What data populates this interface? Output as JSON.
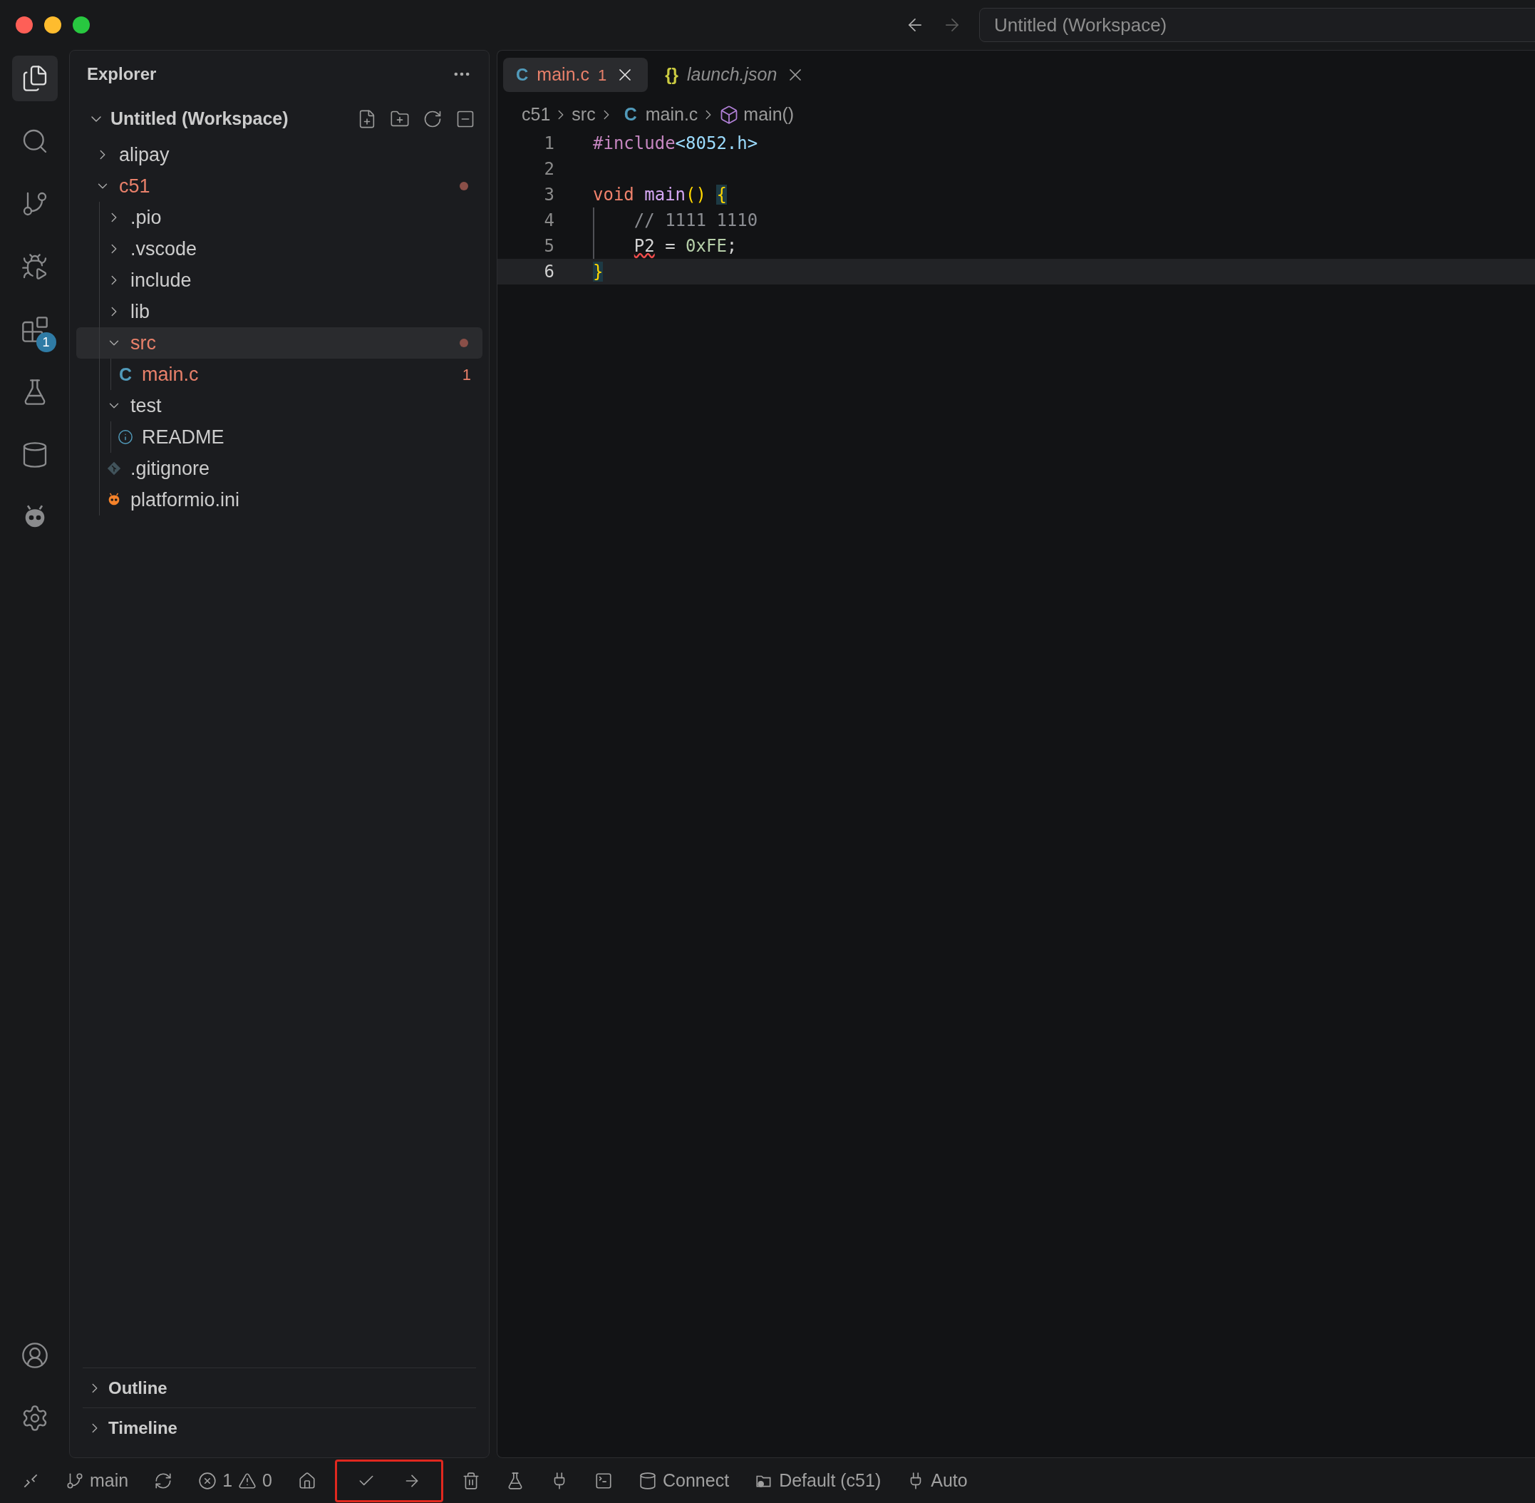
{
  "window": {
    "title": "Untitled (Workspace)",
    "back_enabled": true,
    "forward_enabled": false
  },
  "activity_bar": {
    "items": [
      {
        "kind": "files",
        "selected": true
      },
      {
        "kind": "search",
        "selected": false
      },
      {
        "kind": "source-control",
        "selected": false
      },
      {
        "kind": "run-debug",
        "selected": false
      },
      {
        "kind": "extensions",
        "selected": false,
        "badge": "1"
      },
      {
        "kind": "testing",
        "selected": false
      },
      {
        "kind": "database",
        "selected": false
      },
      {
        "kind": "platformio",
        "selected": false
      }
    ],
    "bottom": [
      {
        "kind": "account"
      },
      {
        "kind": "settings"
      }
    ]
  },
  "explorer": {
    "title": "Explorer",
    "workspace": {
      "label": "Untitled (Workspace)",
      "expanded": true
    },
    "tree": [
      {
        "label": "alipay",
        "kind": "folder",
        "expanded": false,
        "selected": false,
        "error": false
      },
      {
        "label": "c51",
        "kind": "folder",
        "expanded": true,
        "selected": false,
        "error": true,
        "children": [
          {
            "label": ".pio",
            "kind": "folder",
            "expanded": false,
            "selected": false,
            "error": false
          },
          {
            "label": ".vscode",
            "kind": "folder",
            "expanded": false,
            "selected": false,
            "error": false
          },
          {
            "label": "include",
            "kind": "folder",
            "expanded": false,
            "selected": false,
            "error": false
          },
          {
            "label": "lib",
            "kind": "folder",
            "expanded": false,
            "selected": false,
            "error": false
          },
          {
            "label": "src",
            "kind": "folder",
            "expanded": true,
            "selected": true,
            "error": true,
            "children": [
              {
                "label": "main.c",
                "kind": "glyph-file",
                "icon": "C",
                "selected": false,
                "error": true,
                "problems": "1"
              }
            ]
          },
          {
            "label": "test",
            "kind": "folder",
            "expanded": true,
            "selected": false,
            "error": false,
            "children": [
              {
                "label": "README",
                "kind": "info-file",
                "selected": false,
                "error": false
              }
            ]
          },
          {
            "label": ".gitignore",
            "kind": "git-file",
            "selected": false,
            "error": false
          },
          {
            "label": "platformio.ini",
            "kind": "platformio-file",
            "selected": false,
            "error": false
          }
        ]
      }
    ],
    "sections": [
      {
        "label": "Outline",
        "expanded": false
      },
      {
        "label": "Timeline",
        "expanded": false
      }
    ]
  },
  "editor": {
    "tabs": [
      {
        "label": "main.c",
        "icon": "C",
        "kind": "c",
        "problems": "1",
        "error": true,
        "selected": true,
        "preview": false
      },
      {
        "label": "launch.json",
        "icon": "{}",
        "kind": "json",
        "selected": false,
        "preview": true,
        "error": false
      }
    ],
    "breadcrumbs": [
      {
        "label": "c51",
        "kind": "folder"
      },
      {
        "label": "src",
        "kind": "folder"
      },
      {
        "label": "main.c",
        "kind": "file",
        "icon": "C"
      },
      {
        "label": "main()",
        "kind": "function"
      }
    ],
    "lines": [
      {
        "number": "1",
        "current": false,
        "tokens": [
          {
            "text": "#include",
            "kind": "directive"
          },
          {
            "text": "<8052.h>",
            "kind": "header"
          }
        ]
      },
      {
        "number": "2",
        "current": false
      },
      {
        "number": "3",
        "current": false,
        "tokens": [
          {
            "text": "void ",
            "kind": "keyword"
          },
          {
            "text": "main",
            "kind": "function"
          },
          {
            "text": "() ",
            "kind": "bracket"
          },
          {
            "text": "{",
            "kind": "bracket",
            "matched": true
          }
        ]
      },
      {
        "number": "4",
        "current": false,
        "tokens": [
          {
            "text": "    // 1111 1110",
            "kind": "comment"
          }
        ]
      },
      {
        "number": "5",
        "current": false,
        "tokens": [
          {
            "text": "    P2",
            "kind": "plain",
            "error": true
          },
          {
            "text": " = ",
            "kind": "plain"
          },
          {
            "text": "0xFE",
            "kind": "number"
          },
          {
            "text": ";",
            "kind": "plain"
          }
        ]
      },
      {
        "number": "6",
        "current": true,
        "tokens": [
          {
            "text": "}",
            "kind": "bracket",
            "matched": true
          }
        ]
      }
    ]
  },
  "status_bar": {
    "groups": [
      {
        "highlighted": false,
        "items": [
          {
            "kind": "remote"
          },
          {
            "kind": "branch",
            "text": "main"
          },
          {
            "kind": "sync"
          },
          {
            "kind": "problems",
            "errors": "1",
            "warnings": "0"
          },
          {
            "kind": "home"
          }
        ]
      },
      {
        "highlighted": true,
        "items": [
          {
            "kind": "build"
          },
          {
            "kind": "upload"
          }
        ]
      },
      {
        "highlighted": false,
        "items": [
          {
            "kind": "clean"
          },
          {
            "kind": "test"
          },
          {
            "kind": "monitor"
          },
          {
            "kind": "terminal"
          },
          {
            "kind": "connect",
            "text": "Connect"
          },
          {
            "kind": "environment",
            "text": "Default (c51)"
          },
          {
            "kind": "port",
            "text": "Auto"
          }
        ]
      }
    ]
  }
}
